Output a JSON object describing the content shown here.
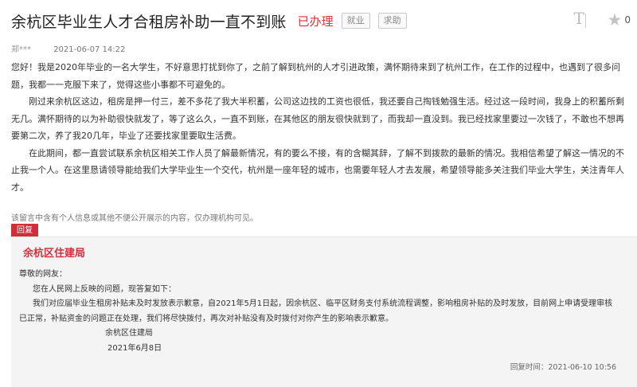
{
  "header": {
    "title": "余杭区毕业生人才合租房补助一直不到账",
    "status": "已办理",
    "tags": [
      "就业",
      "求助"
    ],
    "font_icon_text": "T",
    "star_count": "0"
  },
  "meta": {
    "author": "郑***",
    "date": "2021-06-07 14:22"
  },
  "post": {
    "paragraphs": [
      "您好！我是2020年毕业的一名大学生，不好意思打扰到你了，之前了解到杭州的人才引进政策，满怀期待来到了杭州工作，在工作的过程中，也遇到了很多问题，我都一一克服下来了，觉得这些小事都不可避免的。",
      "刚过来余杭区这边，租房是押一付三，差不多花了我大半积蓄，公司这边找的工资也很低，我还要自己掏钱勉强生活。经过这一段时间，我身上的积蓄所剩无几。满怀期待的以为补助很快就发了，等了这么久，一直不到账，在其他区的朋友很快就到了，而我却一直没到。我已经找家里要过一次钱了，不敢也不想再要第二次，养了我20几年，毕业了还要找家里要取生活费。",
      "在此期间，都一直尝试联系余杭区相关工作人员了解最新情况，有的要么不接，有的含糊其辞，了解不到拨款的最新的情况。我相信希望了解这一情况的不止我一个人。在这里恳请领导能给我们大学毕业生一个交代，杭州是一座年轻的城市，也需要年轻人才去发展，希望领导能多关注我们毕业大学生，关注青年人才。"
    ]
  },
  "notice": "该留言中含有个人信息或其他不便公开展示的内容，仅办理机构可见。",
  "reply": {
    "tag_label": "回复",
    "department": "余杭区住建局",
    "greeting": "尊敬的网友：",
    "intro": "您在人民网上反映的问题，现答复如下：",
    "body": "我们对应届毕业生租房补贴未及时发放表示歉意，自2021年5月1日起，因余杭区、临平区财务支付系统流程调整，影响租房补贴的及时发放，目前网上申请受理审核已正常，补贴资金的问题正在处理，我们将尽快拨付，再次对补贴没有及时拨付对你产生的影响表示歉意。",
    "signature": "余杭区住建局",
    "sign_date": "2021年6月8日",
    "reply_time": "回复时间：2021-06-10 10:56"
  }
}
